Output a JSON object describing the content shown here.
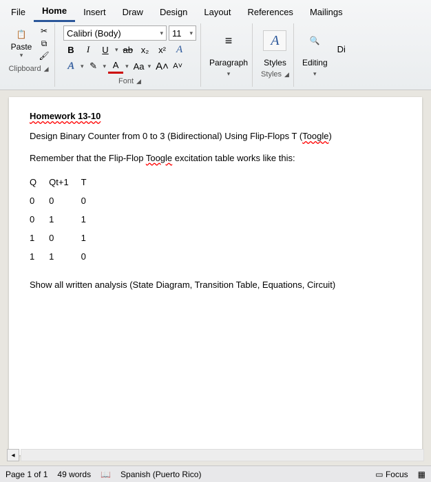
{
  "tabs": {
    "file": "File",
    "home": "Home",
    "insert": "Insert",
    "draw": "Draw",
    "design": "Design",
    "layout": "Layout",
    "references": "References",
    "mailings": "Mailings"
  },
  "clipboard": {
    "paste": "Paste",
    "label": "Clipboard"
  },
  "font": {
    "family": "Calibri (Body)",
    "size": "11",
    "bold": "B",
    "italic": "I",
    "underline": "U",
    "strike": "ab",
    "subscript": "x₂",
    "superscript": "x²",
    "textEffects": "A",
    "fontColorA": "A",
    "highlight": "✎",
    "fontColor": "A",
    "aa": "Aa",
    "growA": "A˄",
    "shrinkA": "A˅",
    "label": "Font"
  },
  "paragraph": {
    "icon": "≡",
    "label": "Paragraph"
  },
  "styles": {
    "bigA": "A",
    "label": "Styles",
    "panelLabel": "Styles"
  },
  "editing": {
    "search": "🔍",
    "label": "Editing",
    "di": "Di"
  },
  "doc": {
    "title": "Homework 13-10",
    "line1a": "Design Binary Counter from 0 to 3 (Bidirectional) Using Flip-Flops T (",
    "line1b": "Toogle",
    "line1c": ")",
    "line2a": "Remember that the Flip-Flop ",
    "line2b": "Toogle",
    "line2c": " excitation table works like this:",
    "th_q": "Q",
    "th_qt1": "Qt+1",
    "th_t": "T",
    "rows": [
      [
        "0",
        "0",
        "0"
      ],
      [
        "0",
        "1",
        "1"
      ],
      [
        "1",
        "0",
        "1"
      ],
      [
        "1",
        "1",
        "0"
      ]
    ],
    "line3a": "Show all written analysis (State Diagram, Transition Table, Equations, ",
    "line3b": "Circuit",
    "line3c": ")"
  },
  "status": {
    "page": "Page 1 of 1",
    "words": "49 words",
    "lang": "Spanish (Puerto Rico)",
    "focus": "Focus"
  }
}
